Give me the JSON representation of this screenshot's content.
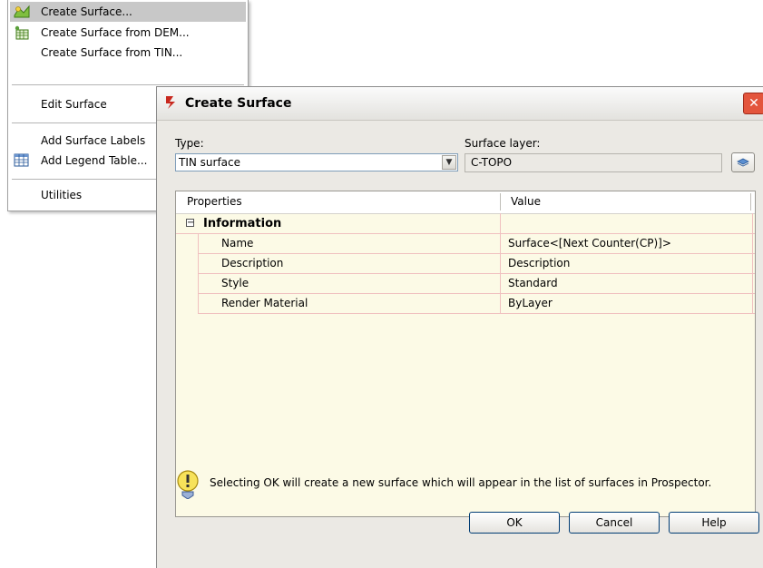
{
  "menu": {
    "items": [
      {
        "label": "Create Surface...",
        "icon": "create-surface-icon",
        "selected": true
      },
      {
        "label": "Create Surface from DEM...",
        "icon": "dem-surface-icon"
      },
      {
        "label": "Create Surface from TIN..."
      },
      {
        "label": "Edit Surface"
      },
      {
        "label": "Add Surface Labels"
      },
      {
        "label": "Add Legend Table...",
        "icon": "table-icon"
      },
      {
        "label": "Utilities"
      }
    ]
  },
  "dialog": {
    "title": "Create Surface",
    "type_label": "Type:",
    "type_value": "TIN surface",
    "layer_label": "Surface layer:",
    "layer_value": "C-TOPO",
    "grid": {
      "headers": [
        "Properties",
        "Value"
      ],
      "group": "Information",
      "rows": [
        {
          "property": "Name",
          "value": "Surface<[Next Counter(CP)]>"
        },
        {
          "property": "Description",
          "value": "Description"
        },
        {
          "property": "Style",
          "value": "Standard"
        },
        {
          "property": "Render Material",
          "value": "ByLayer"
        }
      ]
    },
    "info_text": "Selecting OK will create a new surface which will appear in the list of surfaces in Prospector.",
    "buttons": {
      "ok": "OK",
      "cancel": "Cancel",
      "help": "Help"
    }
  },
  "colors": {
    "grid_bg": "#fcfae6",
    "menu_selected": "#c8c8c8",
    "close": "#e3553c"
  }
}
